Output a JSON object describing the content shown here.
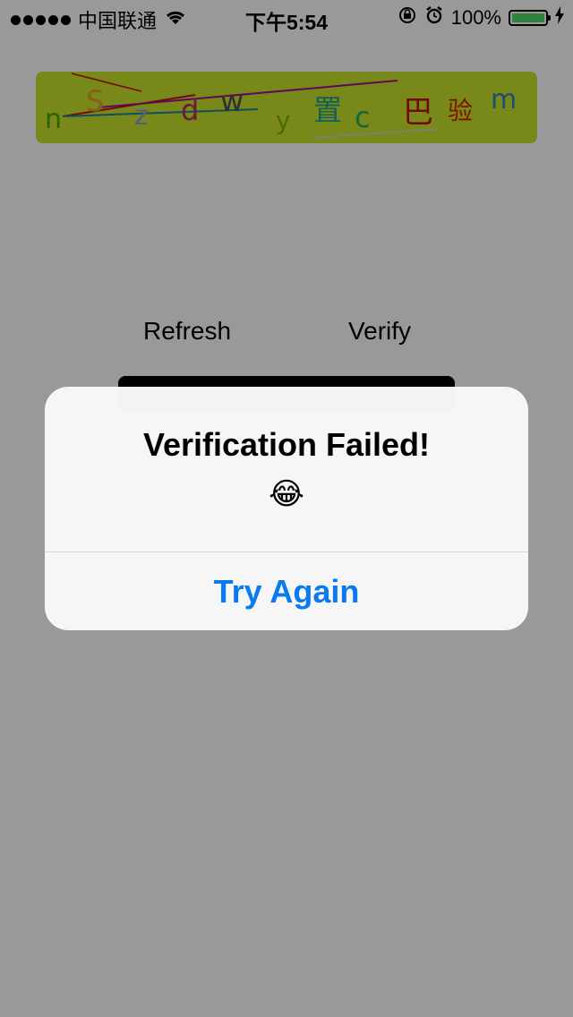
{
  "status_bar": {
    "carrier": "中国联通",
    "time": "下午5:54",
    "battery_percent": "100%",
    "battery_level": 1.0,
    "icons": [
      "signal-dots-icon",
      "wifi-icon",
      "rotation-lock-icon",
      "alarm-icon",
      "battery-icon",
      "charging-icon"
    ]
  },
  "captcha": {
    "background": "#c9e32a",
    "characters": [
      {
        "text": "n",
        "color": "#4ea000"
      },
      {
        "text": "S",
        "color": "#e0a030"
      },
      {
        "text": "z",
        "color": "#8aa0d0"
      },
      {
        "text": "d",
        "color": "#b03060"
      },
      {
        "text": "w",
        "color": "#505050"
      },
      {
        "text": "y",
        "color": "#7ab400"
      },
      {
        "text": "置",
        "color": "#20a090"
      },
      {
        "text": "c",
        "color": "#20b060"
      },
      {
        "text": "巴",
        "color": "#c01010"
      },
      {
        "text": "验",
        "color": "#d02000"
      },
      {
        "text": "m",
        "color": "#3080c0"
      }
    ]
  },
  "actions": {
    "refresh_label": "Refresh",
    "verify_label": "Verify"
  },
  "alert": {
    "title": "Verification Failed!",
    "message": "😂",
    "button_label": "Try Again",
    "button_color": "#0a7af0"
  }
}
